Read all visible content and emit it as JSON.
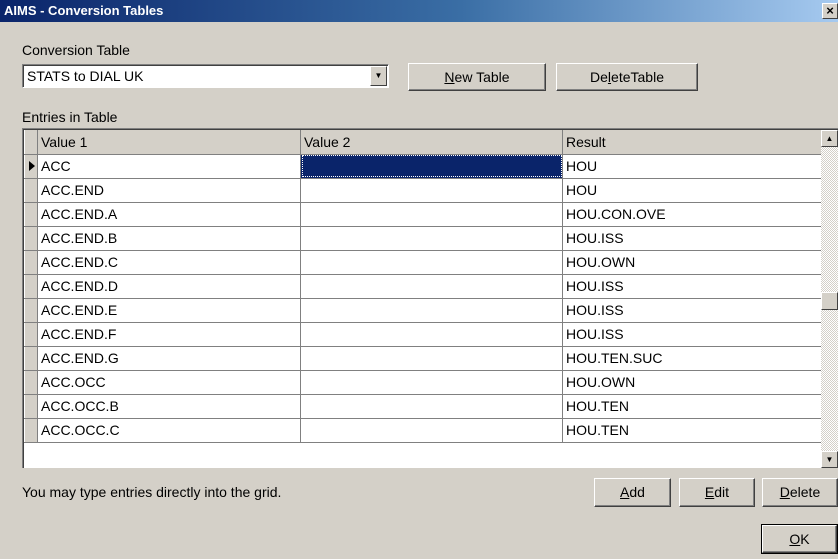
{
  "window": {
    "title": "AIMS - Conversion Tables",
    "close_glyph": "×"
  },
  "conversion_table": {
    "label": "Conversion Table",
    "selected": "STATS to DIAL UK",
    "dropdown_glyph": "▼"
  },
  "buttons": {
    "new_table": {
      "pre": "",
      "key": "N",
      "post": "ew Table"
    },
    "delete_table": {
      "pre": "De",
      "key": "l",
      "post": "eteTable"
    },
    "add": {
      "pre": "",
      "key": "A",
      "post": "dd"
    },
    "edit": {
      "pre": "",
      "key": "E",
      "post": "dit"
    },
    "delete": {
      "pre": "",
      "key": "D",
      "post": "elete"
    },
    "ok": {
      "pre": "",
      "key": "O",
      "post": "K"
    }
  },
  "entries": {
    "label": "Entries in Table",
    "columns": [
      "Value 1",
      "Value 2",
      "Result"
    ],
    "rows": [
      [
        "ACC",
        "",
        "HOU"
      ],
      [
        "ACC.END",
        "",
        "HOU"
      ],
      [
        "ACC.END.A",
        "",
        "HOU.CON.OVE"
      ],
      [
        "ACC.END.B",
        "",
        "HOU.ISS"
      ],
      [
        "ACC.END.C",
        "",
        "HOU.OWN"
      ],
      [
        "ACC.END.D",
        "",
        "HOU.ISS"
      ],
      [
        "ACC.END.E",
        "",
        "HOU.ISS"
      ],
      [
        "ACC.END.F",
        "",
        "HOU.ISS"
      ],
      [
        "ACC.END.G",
        "",
        "HOU.TEN.SUC"
      ],
      [
        "ACC.OCC",
        "",
        "HOU.OWN"
      ],
      [
        "ACC.OCC.B",
        "",
        "HOU.TEN"
      ],
      [
        "ACC.OCC.C",
        "",
        "HOU.TEN"
      ]
    ],
    "scroll_up_glyph": "▲",
    "scroll_down_glyph": "▼"
  },
  "hint": "You may type entries directly into the grid.",
  "colors": {
    "title_bar": "#0a246a",
    "selection": "#0a246a",
    "face": "#d4d0c8"
  }
}
